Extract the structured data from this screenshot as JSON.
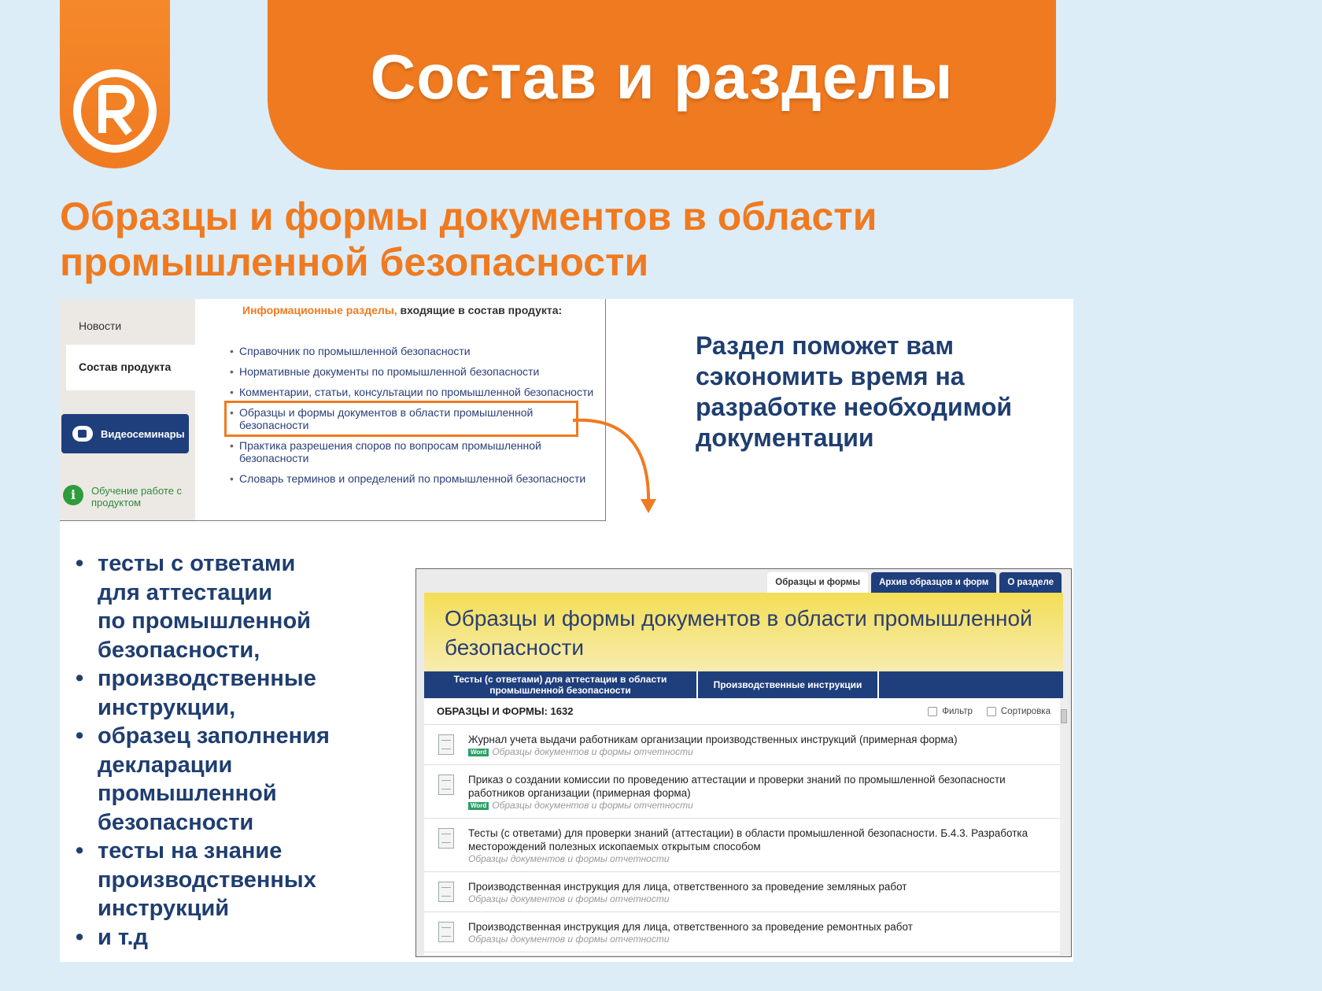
{
  "header": {
    "title": "Состав и разделы",
    "logo_icon": "registered-r-logo-icon"
  },
  "subtitle": "Образцы и формы документов в области промышленной безопасности",
  "callout": "Раздел поможет вам сэкономить время на разработке необходимой документации",
  "colors": {
    "accent": "#f07a20",
    "navy": "#1f3e70",
    "background": "#dcedf8"
  },
  "bullets": [
    "тесты с ответами\nдля аттестации\nпо промышленной\nбезопасности,",
    "производственные\nинструкции,",
    "образец заполнения\nдекларации\nпромышленной\nбезопасности",
    "тесты на знание\nпроизводственных\nинструкций",
    "и т.д"
  ],
  "screenshot_top": {
    "sidebar": {
      "news": "Новости",
      "product": "Состав продукта",
      "webinars": "Видеосеминары",
      "learning": "Обучение работе с продуктом"
    },
    "heading_orange": "Информационные разделы,",
    "heading_dark": " входящие в состав продукта:",
    "items": [
      "Справочник по промышленной безопасности",
      "Нормативные документы по промышленной безопасности",
      "Комментарии, статьи, консультации по промышленной безопасности",
      "Образцы и формы документов в области промышленной безопасности",
      "Практика разрешения споров по вопросам промышленной безопасности",
      "Словарь терминов и определений по промышленной безопасности"
    ]
  },
  "screenshot_bottom": {
    "tabs": [
      "Образцы и формы",
      "Архив образцов и форм",
      "О разделе"
    ],
    "title": "Образцы и формы документов в области промышленной безопасности",
    "subtabs": [
      "Тесты (с ответами) для аттестации в области промышленной безопасности",
      "Производственные инструкции"
    ],
    "count_label": "ОБРАЗЦЫ И ФОРМЫ: 1632",
    "filter": "Фильтр",
    "sort": "Сортировка",
    "word_badge": "Word",
    "docs": [
      {
        "name": "Журнал учета выдачи работникам организации производственных инструкций (примерная форма)",
        "meta": "Образцы документов и формы отчетности",
        "word": true
      },
      {
        "name": "Приказ о создании комиссии по проведению аттестации и проверки знаний по промышленной безопасности работников организации (примерная форма)",
        "meta": "Образцы документов и формы отчетности",
        "word": true
      },
      {
        "name": "Тесты (с ответами) для проверки знаний (аттестации) в области промышленной безопасности. Б.4.3. Разработка месторождений полезных ископаемых открытым способом",
        "meta": "Образцы документов и формы отчетности",
        "word": false
      },
      {
        "name": "Производственная инструкция для лица, ответственного за проведение земляных работ",
        "meta": "Образцы документов и формы отчетности",
        "word": false
      },
      {
        "name": "Производственная инструкция для лица, ответственного за проведение ремонтных работ",
        "meta": "Образцы документов и формы отчетности",
        "word": false
      }
    ]
  }
}
